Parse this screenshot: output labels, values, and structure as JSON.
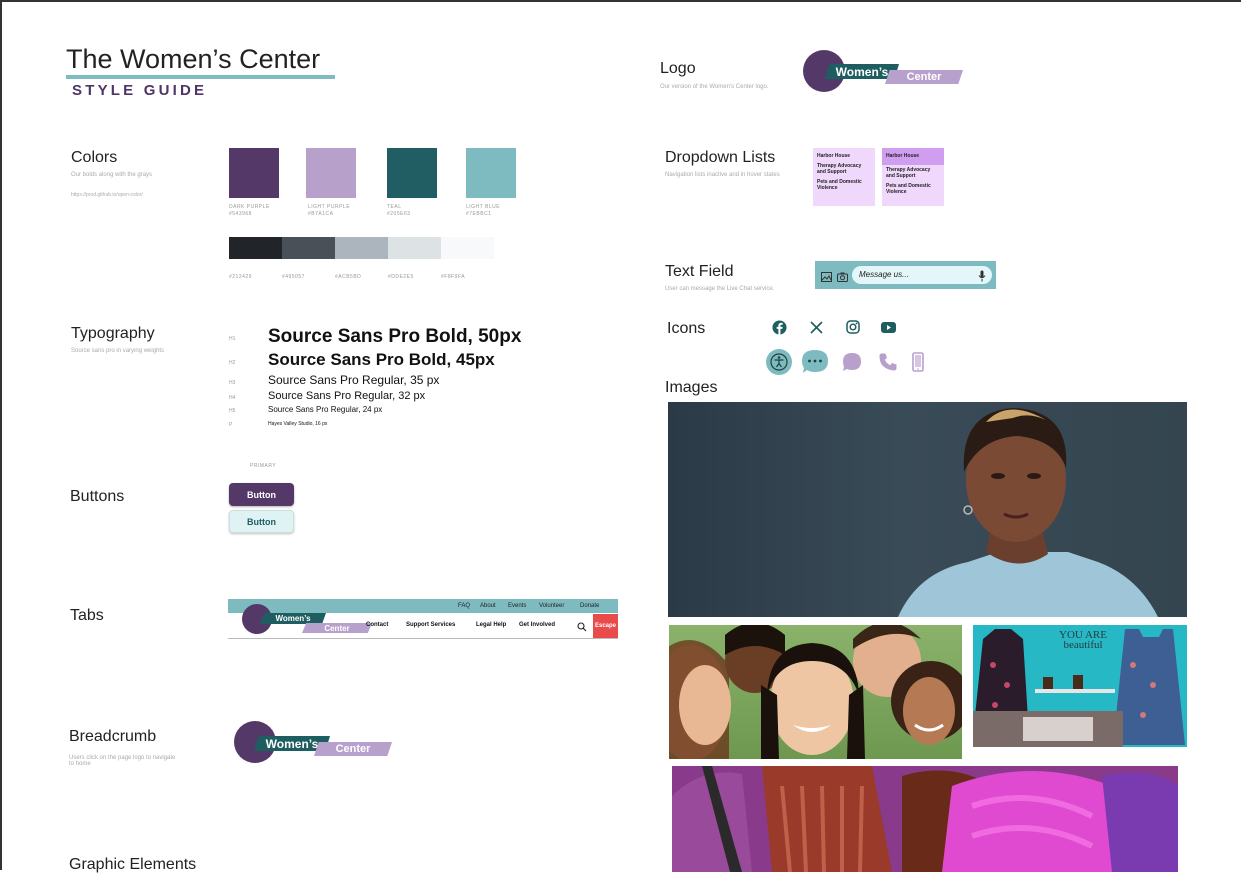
{
  "header": {
    "title": "The Women’s Center",
    "subtitle": "STYLE GUIDE"
  },
  "colors": {
    "title": "Colors",
    "desc": "Our bolds along with the grays",
    "link": "https://prod.github.io/open-color/",
    "swatches": [
      {
        "name": "DARK PURPLE",
        "hex": "#543968"
      },
      {
        "name": "LIGHT PURPLE",
        "hex": "#B7A1CA"
      },
      {
        "name": "TEAL",
        "hex": "#205E63"
      },
      {
        "name": "LIGHT BLUE",
        "hex": "#7EBBC1"
      }
    ],
    "grays": [
      "#212429",
      "#495057",
      "#ACB5BD",
      "#DDE2E5",
      "#F8F9FA"
    ]
  },
  "typography": {
    "title": "Typography",
    "desc": "Source sans pro in varying weights",
    "lines": [
      {
        "tag": "H1",
        "text": "Source Sans Pro Bold, 50px"
      },
      {
        "tag": "H2",
        "text": "Source Sans Pro Bold, 45px"
      },
      {
        "tag": "H3",
        "text": "Source Sans Pro Regular, 35 px"
      },
      {
        "tag": "H4",
        "text": "Source Sans Pro Regular, 32 px"
      },
      {
        "tag": "H5",
        "text": "Source Sans Pro Regular, 24 px"
      },
      {
        "tag": "P",
        "text": "Hayes Valley Studio, 16 px"
      }
    ]
  },
  "buttons": {
    "title": "Buttons",
    "primary_label": "PRIMARY",
    "btn1": "Button",
    "btn2": "Button"
  },
  "tabs": {
    "title": "Tabs",
    "top_links": [
      "FAQ",
      "About",
      "Events",
      "Volunteer",
      "Donate"
    ],
    "main_links": [
      "Contact",
      "Support Services",
      "Legal Help",
      "Get Involved"
    ],
    "escape": "Escape"
  },
  "breadcrumb": {
    "title": "Breadcrumb",
    "desc": "Users click on the page logo to navigate to home"
  },
  "graphic": {
    "title": "Graphic Elements"
  },
  "logo_section": {
    "title": "Logo",
    "desc": "Our version of the Women’s Center logo."
  },
  "logo": {
    "line1": "Women’s",
    "line2": "Center"
  },
  "dropdown": {
    "title": "Dropdown Lists",
    "desc": "Navigation lists inactive and in hover states",
    "items": [
      "Harbor House",
      "Therapy Advocacy and Support",
      "Pets and Domestic Violence"
    ]
  },
  "textfield": {
    "title": "Text Field",
    "desc": "User can message the Live Chat service.",
    "placeholder": "Message us..."
  },
  "icons": {
    "title": "Icons"
  },
  "images": {
    "title": "Images",
    "sign": "YOU ARE beautiful"
  },
  "palette": {
    "purple": "#543968",
    "lightpurple": "#b7a1ca",
    "teal": "#205e63",
    "lightblue": "#7ebbc1"
  }
}
